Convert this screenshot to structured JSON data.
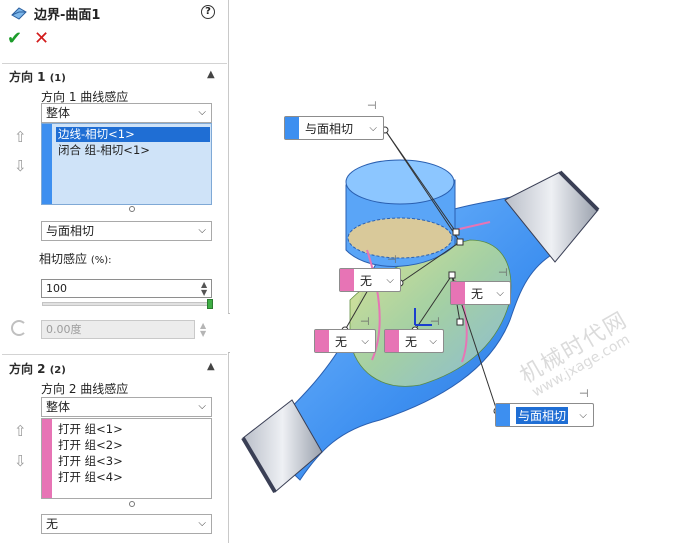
{
  "panel": {
    "title": "边界-曲面1",
    "help": "?",
    "ok": "✔",
    "cancel": "✕",
    "dir1": {
      "title": "方向 1",
      "count": "(1)",
      "curve_label": "方向 1 曲线感应",
      "curve_value": "整体",
      "list": [
        "边线-相切<1>",
        "闭合 组-相切<1>"
      ],
      "tangency_value": "与面相切",
      "tangency_label": "相切感应",
      "tangency_unit": "(%):",
      "tangency_input": "100",
      "tangency_fraction": 1.0,
      "angle_input": "0.00度"
    },
    "dir2": {
      "title": "方向 2",
      "count": "(2)",
      "curve_label": "方向 2 曲线感应",
      "curve_value": "整体",
      "list": [
        "打开 组<1>",
        "打开 组<2>",
        "打开 组<3>",
        "打开 组<4>"
      ],
      "tangency_value": "无"
    }
  },
  "viewport": {
    "callouts": {
      "top": "与面相切",
      "mid_left": "无",
      "mid_right": "无",
      "bottom_left": "无",
      "bottom_mid": "无",
      "bottom_right": "与面相切"
    },
    "watermark_cn": "机械时代网",
    "watermark_url": "www.jxage.com"
  },
  "colors": {
    "dir1_strip": "#3d8ff0",
    "dir2_strip": "#e774b5",
    "selection": "#1f6ed4",
    "surface_blue": "#3d8ff0",
    "ok_green": "#1c9c2a",
    "cancel_red": "#d21b1b"
  }
}
